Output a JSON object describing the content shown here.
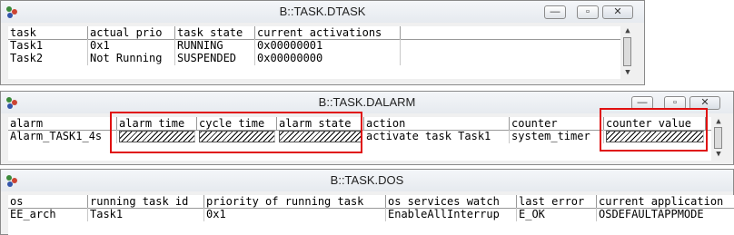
{
  "dtask": {
    "title": "B::TASK.DTASK",
    "columns": [
      "task",
      "actual prio",
      "task state",
      "current activations"
    ],
    "rows": [
      [
        "Task1",
        "0x1",
        "RUNNING",
        "0x00000001"
      ],
      [
        "Task2",
        "Not Running",
        "SUSPENDED",
        "0x00000000"
      ]
    ],
    "buttons": {
      "minimize": "—",
      "maximize": "▫",
      "close": "✕"
    }
  },
  "dalarm": {
    "title": "B::TASK.DALARM",
    "columns": [
      "alarm",
      "alarm time",
      "cycle time",
      "alarm state",
      "action",
      "counter",
      "counter value"
    ],
    "rows": [
      [
        "Alarm_TASK1_4s",
        "",
        "",
        "",
        "activate task Task1",
        "system_timer",
        ""
      ]
    ],
    "buttons": {
      "minimize": "—",
      "maximize": "▫",
      "close": "✕"
    }
  },
  "dos": {
    "title": "B::TASK.DOS",
    "columns": [
      "os",
      "running task id",
      "priority of running task",
      "os services watch",
      "last error",
      "current application"
    ],
    "rows": [
      [
        "EE_arch",
        "Task1",
        "0x1",
        "EnableAllInterrup",
        "E_OK",
        "OSDEFAULTAPPMODE"
      ]
    ]
  },
  "icons": {
    "app": "trace32-icon"
  },
  "colors": {
    "highlight": "#e01010"
  }
}
